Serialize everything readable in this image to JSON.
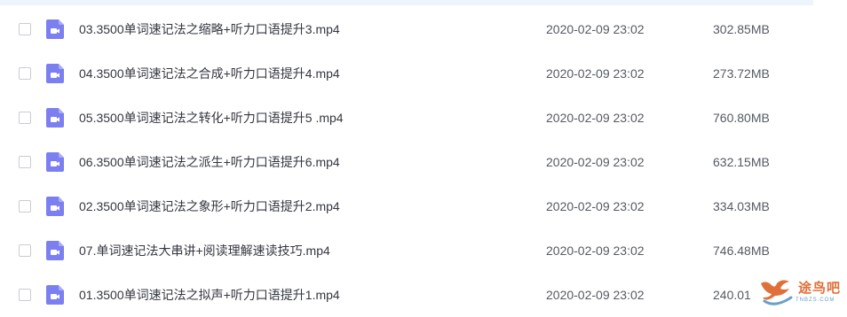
{
  "colors": {
    "video_icon": "#7b7ff0",
    "watermark": "#e0703a"
  },
  "files": [
    {
      "name": "03.3500单词速记法之缩略+听力口语提升3.mp4",
      "date": "2020-02-09 23:02",
      "size": "302.85MB",
      "icon": "video-file-icon"
    },
    {
      "name": "04.3500单词速记法之合成+听力口语提升4.mp4",
      "date": "2020-02-09 23:02",
      "size": "273.72MB",
      "icon": "video-file-icon"
    },
    {
      "name": "05.3500单词速记法之转化+听力口语提升5 .mp4",
      "date": "2020-02-09 23:02",
      "size": "760.80MB",
      "icon": "video-file-icon"
    },
    {
      "name": "06.3500单词速记法之派生+听力口语提升6.mp4",
      "date": "2020-02-09 23:02",
      "size": "632.15MB",
      "icon": "video-file-icon"
    },
    {
      "name": "02.3500单词速记法之象形+听力口语提升2.mp4",
      "date": "2020-02-09 23:02",
      "size": "334.03MB",
      "icon": "video-file-icon"
    },
    {
      "name": "07.单词速记法大串讲+阅读理解速读技巧.mp4",
      "date": "2020-02-09 23:02",
      "size": "746.48MB",
      "icon": "video-file-icon"
    },
    {
      "name": "01.3500单词速记法之拟声+听力口语提升1.mp4",
      "date": "2020-02-09 23:02",
      "size": "240.01",
      "icon": "video-file-icon"
    }
  ],
  "watermark": {
    "text": "途鸟吧",
    "sub": "TNBZS.COM"
  }
}
